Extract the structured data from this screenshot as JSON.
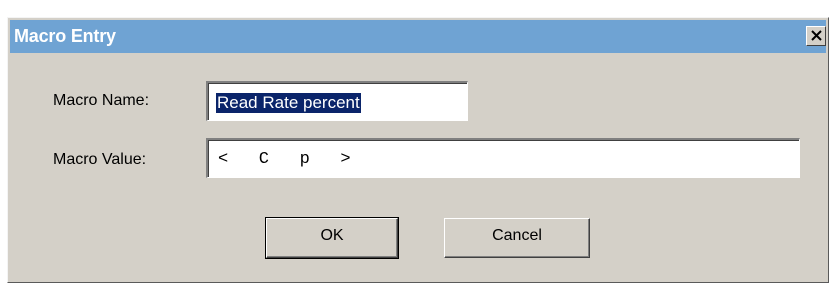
{
  "window": {
    "title": "Macro Entry",
    "close_icon": "close-x-icon"
  },
  "form": {
    "name_label": "Macro Name:",
    "name_value": "Read Rate percent",
    "value_label": "Macro Value:",
    "value_value": "<   C   p   >"
  },
  "buttons": {
    "ok_label": "OK",
    "cancel_label": "Cancel"
  },
  "colors": {
    "titlebar": "#6fa3d3",
    "dialog_face": "#d4d0c8",
    "selection": "#0a246a"
  }
}
